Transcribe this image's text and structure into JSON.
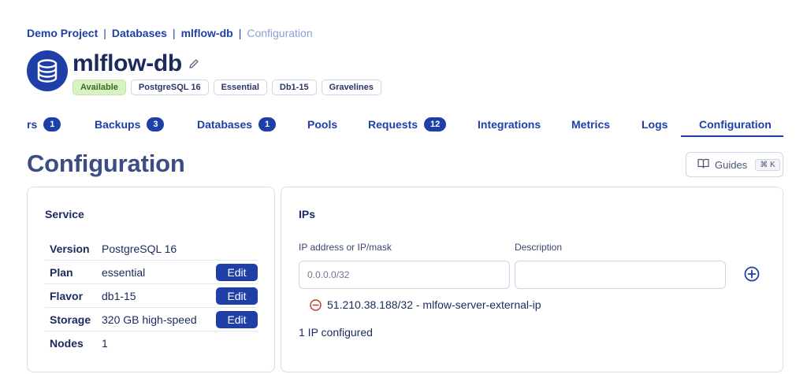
{
  "breadcrumb": {
    "items": [
      "Demo Project",
      "Databases",
      "mlflow-db"
    ],
    "current": "Configuration",
    "separator": "|"
  },
  "header": {
    "title": "mlflow-db",
    "avatar_icon": "database-icon",
    "badges": {
      "status": "Available",
      "engine": "PostgreSQL 16",
      "plan": "Essential",
      "flavor": "Db1-15",
      "region": "Gravelines"
    }
  },
  "tabs": {
    "users": {
      "label": "rs",
      "count": "1"
    },
    "backups": {
      "label": "Backups",
      "count": "3"
    },
    "databases": {
      "label": "Databases",
      "count": "1"
    },
    "pools": {
      "label": "Pools"
    },
    "requests": {
      "label": "Requests",
      "count": "12"
    },
    "integrations": {
      "label": "Integrations"
    },
    "metrics": {
      "label": "Metrics"
    },
    "logs": {
      "label": "Logs"
    },
    "configuration": {
      "label": "Configuration"
    }
  },
  "page_title": "Configuration",
  "guides": {
    "label": "Guides",
    "shortcut": "⌘ K"
  },
  "service": {
    "title": "Service",
    "edit_label": "Edit",
    "rows": {
      "version": {
        "key": "Version",
        "value": "PostgreSQL 16"
      },
      "plan": {
        "key": "Plan",
        "value": "essential"
      },
      "flavor": {
        "key": "Flavor",
        "value": "db1-15"
      },
      "storage": {
        "key": "Storage",
        "value": "320 GB high-speed"
      },
      "nodes": {
        "key": "Nodes",
        "value": "1"
      }
    }
  },
  "ips": {
    "title": "IPs",
    "ip_label": "IP address or IP/mask",
    "ip_placeholder": "0.0.0.0/32",
    "description_label": "Description",
    "description_placeholder": "",
    "entries": [
      "51.210.38.188/32 - mlfow-server-external-ip"
    ],
    "count_text": "1 IP configured"
  },
  "colors": {
    "primary": "#1f3fa8",
    "title": "#1b2a5e",
    "available_bg": "#d8f2c4",
    "remove": "#c0392b"
  }
}
